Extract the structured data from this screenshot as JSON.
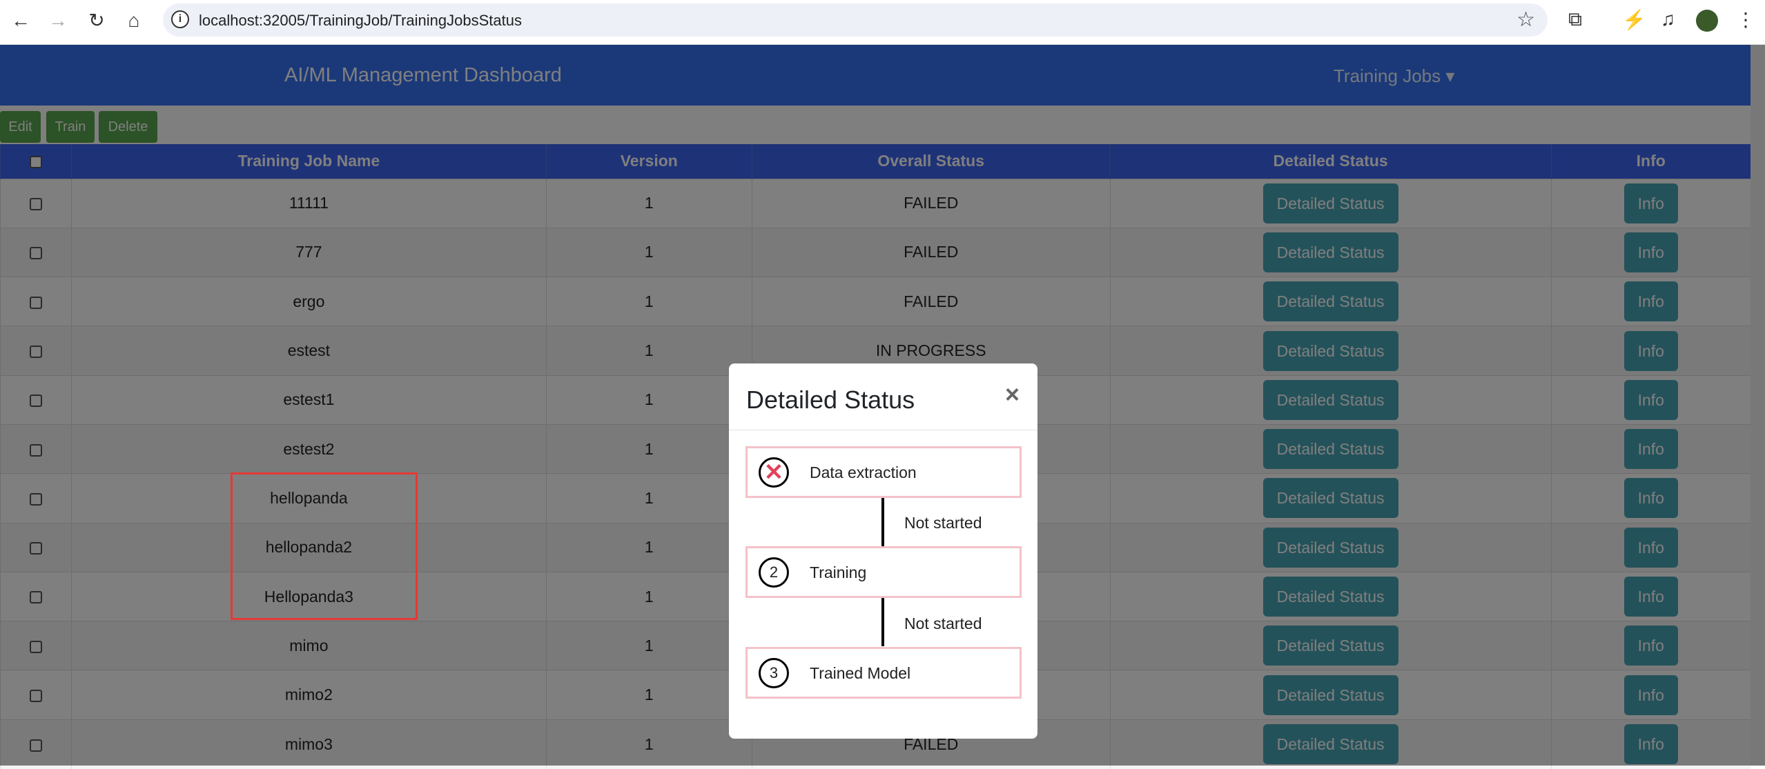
{
  "browser": {
    "url": "localhost:32005/TrainingJob/TrainingJobsStatus"
  },
  "header": {
    "title": "AI/ML Management Dashboard",
    "menu": "Training Jobs ▾"
  },
  "toolbar": {
    "edit": "Edit",
    "train": "Train",
    "delete": "Delete"
  },
  "table": {
    "columns": [
      "Training Job Name",
      "Version",
      "Overall Status",
      "Detailed Status",
      "Info"
    ],
    "detailed_label": "Detailed Status",
    "info_label": "Info",
    "rows": [
      {
        "name": "11111",
        "version": "1",
        "status": "FAILED"
      },
      {
        "name": "777",
        "version": "1",
        "status": "FAILED"
      },
      {
        "name": "ergo",
        "version": "1",
        "status": "FAILED"
      },
      {
        "name": "estest",
        "version": "1",
        "status": "IN PROGRESS"
      },
      {
        "name": "estest1",
        "version": "1",
        "status": ""
      },
      {
        "name": "estest2",
        "version": "1",
        "status": ""
      },
      {
        "name": "hellopanda",
        "version": "1",
        "status": ""
      },
      {
        "name": "hellopanda2",
        "version": "1",
        "status": ""
      },
      {
        "name": "Hellopanda3",
        "version": "1",
        "status": ""
      },
      {
        "name": "mimo",
        "version": "1",
        "status": ""
      },
      {
        "name": "mimo2",
        "version": "1",
        "status": ""
      },
      {
        "name": "mimo3",
        "version": "1",
        "status": "FAILED"
      }
    ]
  },
  "modal": {
    "title": "Detailed Status",
    "close": "×",
    "steps": [
      {
        "marker": "✕",
        "label": "Data extraction"
      },
      {
        "marker": "2",
        "label": "Training"
      },
      {
        "marker": "3",
        "label": "Trained Model"
      }
    ],
    "transitions": [
      "Not started",
      "Not started"
    ]
  }
}
